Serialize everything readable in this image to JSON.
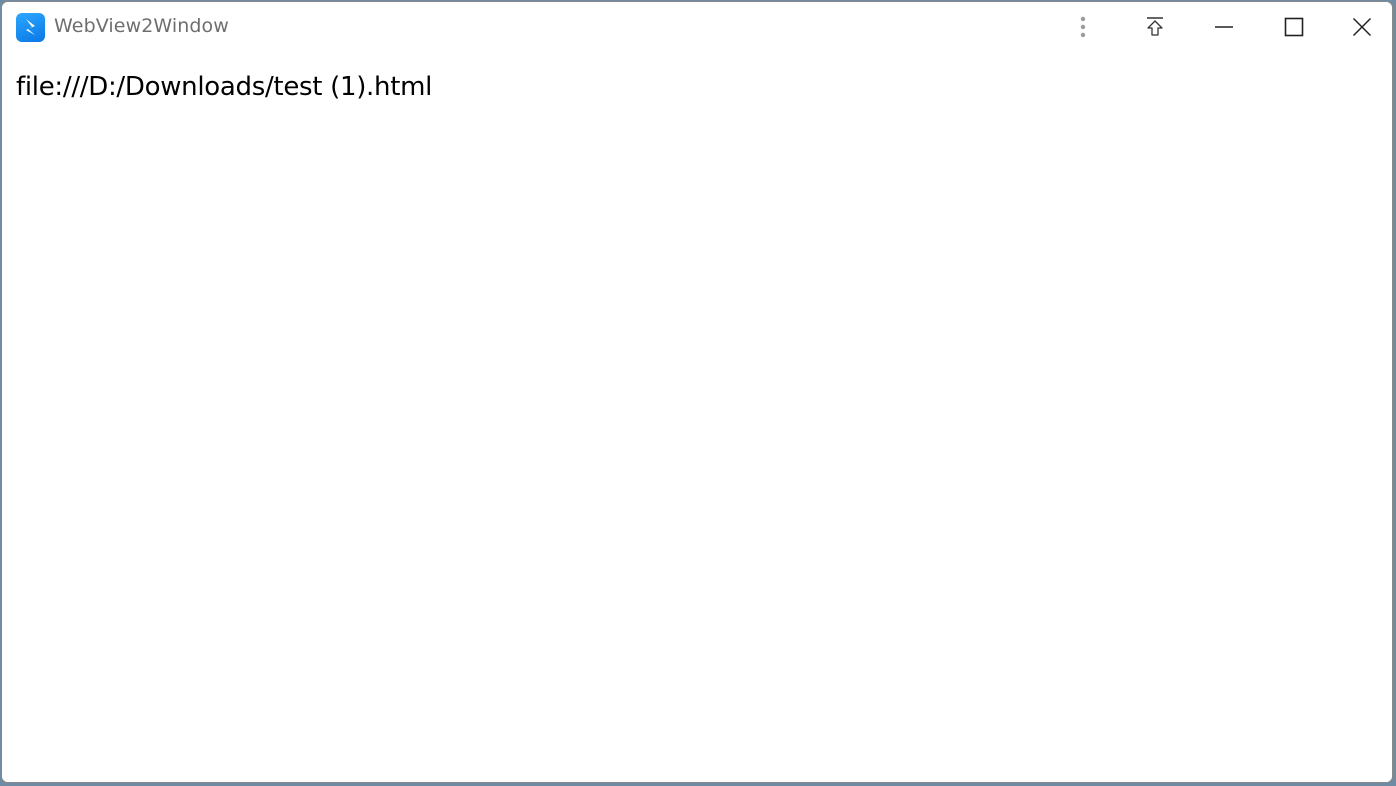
{
  "window": {
    "title": "WebView2Window",
    "app_icon": "webview2-app-icon",
    "accent_color": "#0a78e6"
  },
  "titlebar": {
    "buttons": [
      {
        "name": "more-options",
        "icon": "vertical-ellipsis-icon"
      },
      {
        "name": "pin-on-top",
        "icon": "pin-top-icon"
      },
      {
        "name": "minimize",
        "icon": "minimize-icon"
      },
      {
        "name": "maximize",
        "icon": "maximize-icon"
      },
      {
        "name": "close",
        "icon": "close-icon"
      }
    ]
  },
  "content": {
    "text": "file:///D:/Downloads/test (1).html"
  }
}
